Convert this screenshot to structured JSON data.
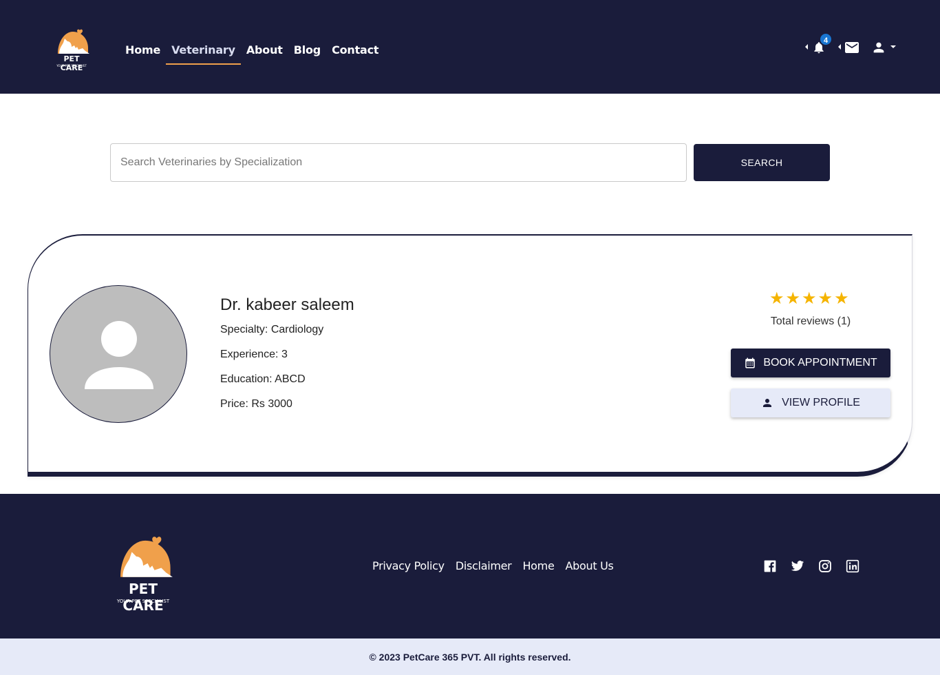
{
  "brand": {
    "name": "PET CARE",
    "tagline": "YOUR PET SPECIALIST",
    "primary_color": "#1a1c3b",
    "accent_color": "#f0a04b"
  },
  "nav": {
    "items": [
      {
        "label": "Home",
        "active": false
      },
      {
        "label": "Veterinary",
        "active": true
      },
      {
        "label": "About",
        "active": false
      },
      {
        "label": "Blog",
        "active": false
      },
      {
        "label": "Contact",
        "active": false
      }
    ]
  },
  "header_icons": {
    "notifications": {
      "icon": "bell-icon",
      "count": "4"
    },
    "messages": {
      "icon": "mail-icon"
    },
    "account": {
      "icon": "user-icon"
    }
  },
  "search": {
    "placeholder": "Search Veterinaries by Specialization",
    "value": "",
    "button_label": "SEARCH"
  },
  "vet_card": {
    "name": "Dr. kabeer saleem",
    "specialty": "Specialty: Cardiology",
    "experience": "Experience: 3",
    "education": "Education: ABCD",
    "price": "Price: Rs 3000",
    "rating": 5,
    "reviews": "Total reviews (1)",
    "book_label": "BOOK APPOINTMENT",
    "view_label": "VIEW PROFILE"
  },
  "footer": {
    "links": [
      "Privacy Policy",
      "Disclaimer",
      "Home",
      "About Us"
    ],
    "social": [
      "facebook-icon",
      "twitter-icon",
      "instagram-icon",
      "linkedin-icon"
    ],
    "copyright": "© 2023 PetCare 365 PVT. All rights reserved."
  }
}
